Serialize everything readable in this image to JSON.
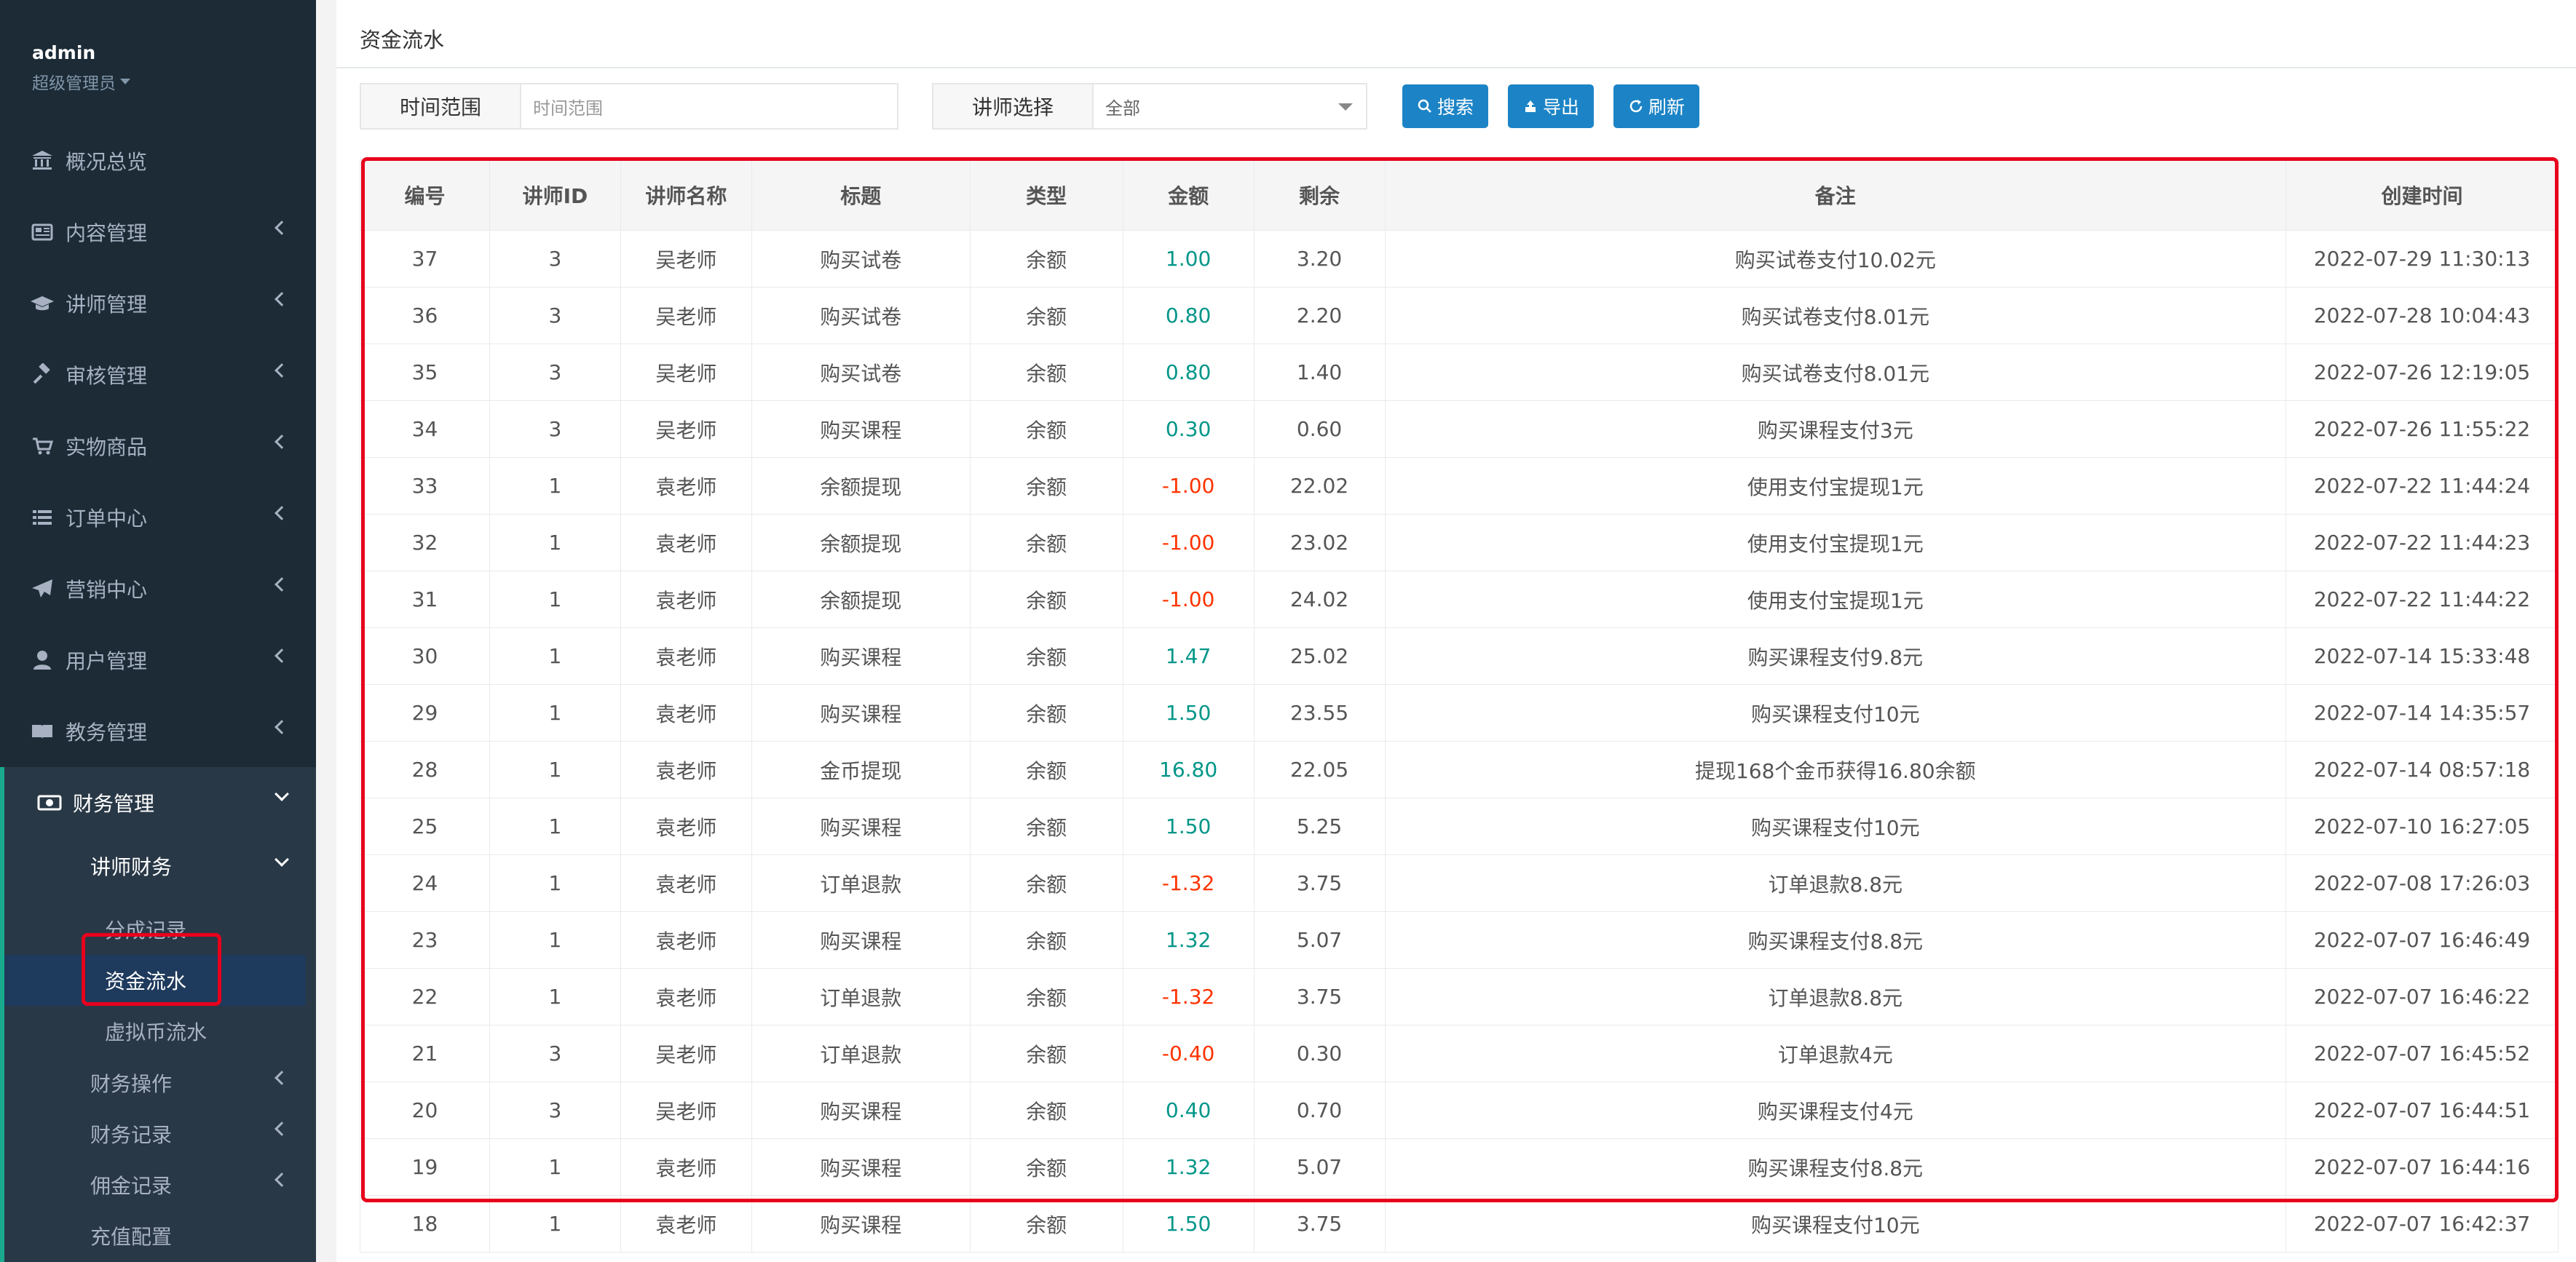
{
  "sidebar": {
    "user": "admin",
    "role": "超级管理员",
    "menu": [
      {
        "label": "概况总览",
        "icon": "bank-icon"
      },
      {
        "label": "内容管理",
        "icon": "newspaper-icon"
      },
      {
        "label": "讲师管理",
        "icon": "graduation-cap-icon"
      },
      {
        "label": "审核管理",
        "icon": "gavel-icon"
      },
      {
        "label": "实物商品",
        "icon": "cart-icon"
      },
      {
        "label": "订单中心",
        "icon": "list-icon"
      },
      {
        "label": "营销中心",
        "icon": "paper-plane-icon"
      },
      {
        "label": "用户管理",
        "icon": "user-icon"
      },
      {
        "label": "教务管理",
        "icon": "book-icon"
      },
      {
        "label": "财务管理",
        "icon": "money-icon"
      }
    ],
    "finance_sub": {
      "head": "讲师财务",
      "leaves": [
        "分成记录",
        "资金流水",
        "虚拟币流水"
      ],
      "others": [
        "财务操作",
        "财务记录",
        "佣金记录",
        "充值配置"
      ]
    }
  },
  "page": {
    "title": "资金流水",
    "filters": {
      "time_label": "时间范围",
      "time_placeholder": "时间范围",
      "teacher_label": "讲师选择",
      "teacher_value": "全部"
    },
    "buttons": {
      "search": "搜索",
      "export": "导出",
      "refresh": "刷新"
    }
  },
  "table": {
    "headers": [
      "编号",
      "讲师ID",
      "讲师名称",
      "标题",
      "类型",
      "金额",
      "剩余",
      "备注",
      "创建时间"
    ],
    "rows": [
      [
        "37",
        "3",
        "吴老师",
        "购买试卷",
        "余额",
        "1.00",
        "3.20",
        "购买试卷支付10.02元",
        "2022-07-29 11:30:13"
      ],
      [
        "36",
        "3",
        "吴老师",
        "购买试卷",
        "余额",
        "0.80",
        "2.20",
        "购买试卷支付8.01元",
        "2022-07-28 10:04:43"
      ],
      [
        "35",
        "3",
        "吴老师",
        "购买试卷",
        "余额",
        "0.80",
        "1.40",
        "购买试卷支付8.01元",
        "2022-07-26 12:19:05"
      ],
      [
        "34",
        "3",
        "吴老师",
        "购买课程",
        "余额",
        "0.30",
        "0.60",
        "购买课程支付3元",
        "2022-07-26 11:55:22"
      ],
      [
        "33",
        "1",
        "袁老师",
        "余额提现",
        "余额",
        "-1.00",
        "22.02",
        "使用支付宝提现1元",
        "2022-07-22 11:44:24"
      ],
      [
        "32",
        "1",
        "袁老师",
        "余额提现",
        "余额",
        "-1.00",
        "23.02",
        "使用支付宝提现1元",
        "2022-07-22 11:44:23"
      ],
      [
        "31",
        "1",
        "袁老师",
        "余额提现",
        "余额",
        "-1.00",
        "24.02",
        "使用支付宝提现1元",
        "2022-07-22 11:44:22"
      ],
      [
        "30",
        "1",
        "袁老师",
        "购买课程",
        "余额",
        "1.47",
        "25.02",
        "购买课程支付9.8元",
        "2022-07-14 15:33:48"
      ],
      [
        "29",
        "1",
        "袁老师",
        "购买课程",
        "余额",
        "1.50",
        "23.55",
        "购买课程支付10元",
        "2022-07-14 14:35:57"
      ],
      [
        "28",
        "1",
        "袁老师",
        "金币提现",
        "余额",
        "16.80",
        "22.05",
        "提现168个金币获得16.80余额",
        "2022-07-14 08:57:18"
      ],
      [
        "25",
        "1",
        "袁老师",
        "购买课程",
        "余额",
        "1.50",
        "5.25",
        "购买课程支付10元",
        "2022-07-10 16:27:05"
      ],
      [
        "24",
        "1",
        "袁老师",
        "订单退款",
        "余额",
        "-1.32",
        "3.75",
        "订单退款8.8元",
        "2022-07-08 17:26:03"
      ],
      [
        "23",
        "1",
        "袁老师",
        "购买课程",
        "余额",
        "1.32",
        "5.07",
        "购买课程支付8.8元",
        "2022-07-07 16:46:49"
      ],
      [
        "22",
        "1",
        "袁老师",
        "订单退款",
        "余额",
        "-1.32",
        "3.75",
        "订单退款8.8元",
        "2022-07-07 16:46:22"
      ],
      [
        "21",
        "3",
        "吴老师",
        "订单退款",
        "余额",
        "-0.40",
        "0.30",
        "订单退款4元",
        "2022-07-07 16:45:52"
      ],
      [
        "20",
        "3",
        "吴老师",
        "购买课程",
        "余额",
        "0.40",
        "0.70",
        "购买课程支付4元",
        "2022-07-07 16:44:51"
      ],
      [
        "19",
        "1",
        "袁老师",
        "购买课程",
        "余额",
        "1.32",
        "5.07",
        "购买课程支付8.8元",
        "2022-07-07 16:44:16"
      ],
      [
        "18",
        "1",
        "袁老师",
        "购买课程",
        "余额",
        "1.50",
        "3.75",
        "购买课程支付10元",
        "2022-07-07 16:42:37"
      ]
    ]
  },
  "colors": {
    "positive": "#009688",
    "negative": "#ff3300",
    "primary": "#1c84c6",
    "sidebar": "#1c2b36",
    "highlight": "#e8001c"
  }
}
